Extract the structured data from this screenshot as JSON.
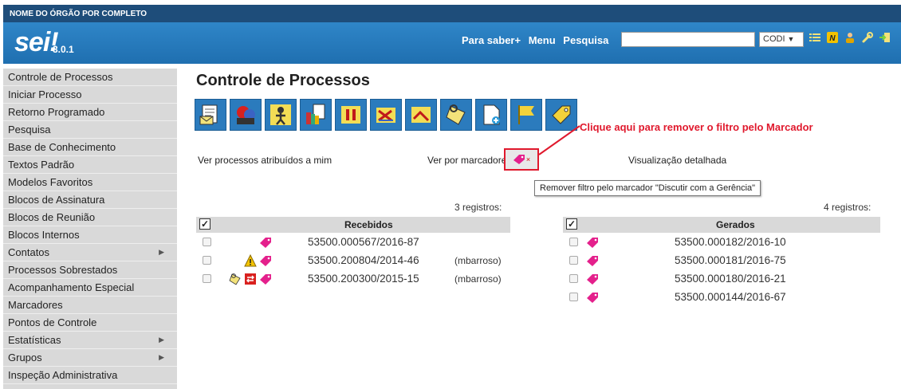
{
  "header": {
    "org_name": "NOME DO ÓRGÃO POR COMPLETO",
    "logo": "sei!",
    "version": "3.0.1",
    "links": [
      "Para saber+",
      "Menu",
      "Pesquisa"
    ],
    "search": {
      "value": "",
      "placeholder": ""
    },
    "unit": "CODI",
    "tool_icons": [
      "list-icon",
      "notes-icon",
      "user-icon",
      "wrench-icon",
      "exit-icon"
    ]
  },
  "sidebar": {
    "items": [
      {
        "label": "Controle de Processos",
        "caret": false
      },
      {
        "label": "Iniciar Processo",
        "caret": false
      },
      {
        "label": "Retorno Programado",
        "caret": false
      },
      {
        "label": "Pesquisa",
        "caret": false
      },
      {
        "label": "Base de Conhecimento",
        "caret": false
      },
      {
        "label": "Textos Padrão",
        "caret": false
      },
      {
        "label": "Modelos Favoritos",
        "caret": false
      },
      {
        "label": "Blocos de Assinatura",
        "caret": false
      },
      {
        "label": "Blocos de Reunião",
        "caret": false
      },
      {
        "label": "Blocos Internos",
        "caret": false
      },
      {
        "label": "Contatos",
        "caret": true
      },
      {
        "label": "Processos Sobrestados",
        "caret": false
      },
      {
        "label": "Acompanhamento Especial",
        "caret": false
      },
      {
        "label": "Marcadores",
        "caret": false
      },
      {
        "label": "Pontos de Controle",
        "caret": false
      },
      {
        "label": "Estatísticas",
        "caret": true
      },
      {
        "label": "Grupos",
        "caret": true
      },
      {
        "label": "Inspeção Administrativa",
        "caret": false
      }
    ]
  },
  "main": {
    "title": "Controle de Processos",
    "toolbar_icons": [
      "send-process-icon",
      "update-progress-icon",
      "assign-process-icon",
      "document-icon",
      "sobrestar-icon",
      "conclude-icon",
      "no-access-icon",
      "notes-icon",
      "new-document-icon",
      "flag-icon",
      "tag-icon"
    ],
    "callout": "Clique aqui para remover o filtro pelo Marcador",
    "filters": {
      "assigned": "Ver processos atribuídos a mim",
      "by_tags": "Ver por marcadores",
      "detailed": "Visualização detalhada"
    },
    "tooltip": "Remover filtro pelo marcador \"Discutir com a Gerência\"",
    "received": {
      "count": "3 registros:",
      "header": "Recebidos",
      "rows": [
        {
          "process": "53500.000567/2016-87",
          "user": "",
          "icons": [
            "tag-icon"
          ]
        },
        {
          "process": "53500.200804/2014-46",
          "user": "(mbarroso)",
          "icons": [
            "warning-icon",
            "tag-icon"
          ]
        },
        {
          "process": "53500.200300/2015-15",
          "user": "(mbarroso)",
          "icons": [
            "note-icon",
            "return-icon",
            "tag-icon"
          ]
        }
      ]
    },
    "generated": {
      "count": "4 registros:",
      "header": "Gerados",
      "rows": [
        {
          "process": "53500.000182/2016-10",
          "icons": [
            "tag-icon"
          ]
        },
        {
          "process": "53500.000181/2016-75",
          "icons": [
            "tag-icon"
          ]
        },
        {
          "process": "53500.000180/2016-21",
          "icons": [
            "tag-icon"
          ]
        },
        {
          "process": "53500.000144/2016-67",
          "icons": [
            "tag-icon"
          ]
        }
      ]
    }
  },
  "colors": {
    "header_blue": "#2b7bbd",
    "tag_magenta": "#e4208c",
    "callout_red": "#e0192d"
  }
}
